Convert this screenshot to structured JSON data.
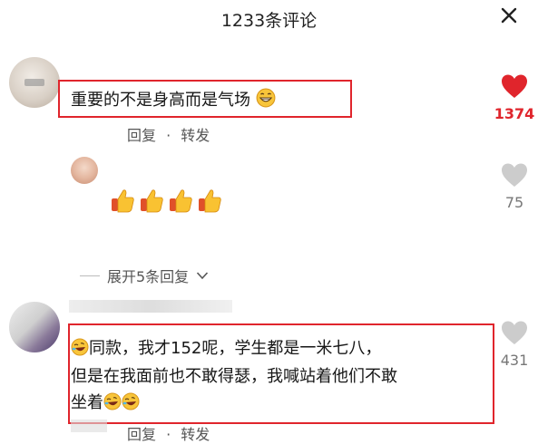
{
  "header": {
    "title": "1233条评论",
    "close_icon": "close-icon"
  },
  "comments": [
    {
      "text": "重要的不是身高而是气场",
      "emoji": "grinning-face",
      "reply_label": "回复",
      "sep": "·",
      "share_label": "转发",
      "likes": "1374",
      "liked": true
    },
    {
      "emoji": "thumbs-up",
      "emoji_count": 4,
      "likes": "75",
      "liked": false,
      "expand_label": "展开5条回复"
    },
    {
      "lines": [
        "同款，我才152呢，学生都是一米七八，",
        "但是在我面前也不敢得瑟，我喊站着他们不敢",
        "坐着"
      ],
      "emoji": "rolling-on-floor-laughing",
      "reply_label": "回复",
      "sep": "·",
      "share_label": "转发",
      "likes": "431",
      "liked": false
    }
  ],
  "colors": {
    "accent": "#e0252c",
    "heart_gray": "#cccccc",
    "text": "#161616",
    "meta": "#555555"
  }
}
